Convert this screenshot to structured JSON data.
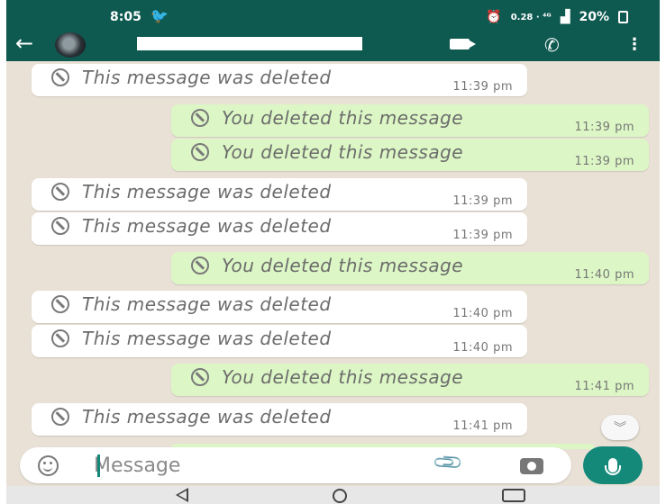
{
  "status_bar": {
    "time": "8:05",
    "network": "0.28 · ⁴ᴳ",
    "battery": "20%"
  },
  "header": {
    "contact_name": ""
  },
  "messages": [
    {
      "direction": "in",
      "text": "This message was deleted",
      "time": "11:39 pm"
    },
    {
      "direction": "out",
      "text": "You deleted this message",
      "time": "11:39 pm"
    },
    {
      "direction": "out",
      "text": "You deleted this message",
      "time": "11:39 pm"
    },
    {
      "direction": "in",
      "text": "This message was deleted",
      "time": "11:39 pm"
    },
    {
      "direction": "in",
      "text": "This message was deleted",
      "time": "11:39 pm"
    },
    {
      "direction": "out",
      "text": "You deleted this message",
      "time": "11:40 pm"
    },
    {
      "direction": "in",
      "text": "This message was deleted",
      "time": "11:40 pm"
    },
    {
      "direction": "in",
      "text": "This message was deleted",
      "time": "11:40 pm"
    },
    {
      "direction": "out",
      "text": "You deleted this message",
      "time": "11:41 pm"
    },
    {
      "direction": "in",
      "text": "This message was deleted",
      "time": "11:41 pm"
    }
  ],
  "composer": {
    "placeholder": "Message"
  },
  "colors": {
    "header": "#0e5950",
    "chat_background": "#e9e1d6",
    "incoming_bubble": "#ffffff",
    "outgoing_bubble": "#dcf7c5",
    "accent": "#14897a"
  },
  "icons": {
    "back": "arrow-left-icon",
    "video_call": "video-camera-icon",
    "voice_call": "phone-icon",
    "menu": "more-vertical-icon",
    "deleted": "ban-icon",
    "emoji": "smiley-icon",
    "attach": "paperclip-icon",
    "camera": "camera-icon",
    "mic": "microphone-icon",
    "scroll_down": "double-chevron-down-icon"
  }
}
